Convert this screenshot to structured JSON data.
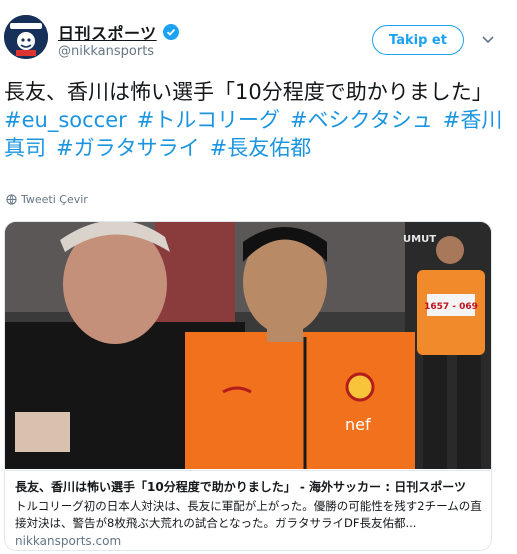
{
  "author": {
    "display_name": "日刊スポーツ",
    "handle": "@nikkansports",
    "verified": true,
    "avatar_icon": "nikkan-logo-icon"
  },
  "follow_button": {
    "label": "Takip et"
  },
  "menu": {
    "icon": "chevron-down-icon"
  },
  "tweet": {
    "text": "長友、香川は怖い選手「10分程度で助かりました」",
    "hashtags": [
      "#eu_soccer",
      "#トルコリーグ",
      "#ベシクタシュ",
      "#香川真司",
      "#ガラタサライ",
      "#長友佑都"
    ]
  },
  "translate": {
    "label": "Tweeti Çevir",
    "icon": "globe-icon"
  },
  "card": {
    "title": "長友、香川は怖い選手「10分程度で助かりました」 - 海外サッカー : 日刊スポーツ",
    "description": "トルコリーグ初の日本人対決は、長友に軍配が上がった。優勝の可能性を残す2チームの直接対決は、警告が8枚飛ぶ大荒れの試合となった。ガラタサライDF長友佑都...",
    "domain": "nikkansports.com",
    "photo_texts": {
      "vest_number": "1657 - 069",
      "banner": "UMUT"
    }
  },
  "colors": {
    "link": "#1b95e0",
    "follow": "#1da1f2",
    "jersey": "#f2711c",
    "muted": "#657786"
  }
}
